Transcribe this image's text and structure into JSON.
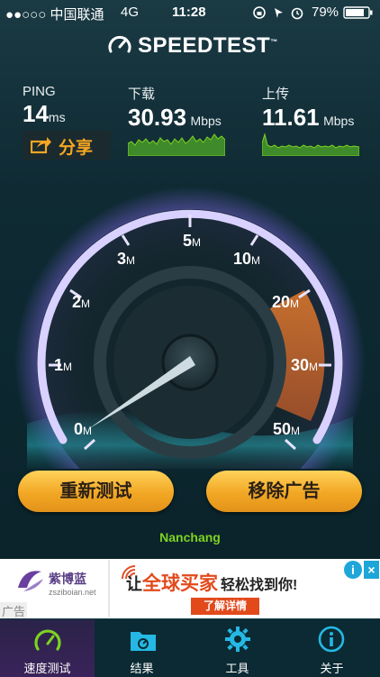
{
  "status": {
    "carrier": "●●○○○ 中国联通",
    "network": "4G",
    "time": "11:28",
    "battery_pct": "79%"
  },
  "header": {
    "brand": "SPEEDTEST",
    "trademark": "™"
  },
  "results": {
    "ping": {
      "label": "PING",
      "value": "14",
      "unit": "ms"
    },
    "download": {
      "label": "下载",
      "value": "30.93",
      "unit": "Mbps"
    },
    "upload": {
      "label": "上传",
      "value": "11.61",
      "unit": "Mbps"
    }
  },
  "share_label": "分享",
  "gauge": {
    "ticks": [
      {
        "num": "0",
        "unit": "M"
      },
      {
        "num": "1",
        "unit": "M"
      },
      {
        "num": "2",
        "unit": "M"
      },
      {
        "num": "3",
        "unit": "M"
      },
      {
        "num": "5",
        "unit": "M"
      },
      {
        "num": "10",
        "unit": "M"
      },
      {
        "num": "20",
        "unit": "M"
      },
      {
        "num": "30",
        "unit": "M"
      },
      {
        "num": "50",
        "unit": "M"
      }
    ]
  },
  "buttons": {
    "retest": "重新测试",
    "remove_ads": "移除广告"
  },
  "server": "Nanchang",
  "ad": {
    "advertiser_cn": "紫博蓝",
    "advertiser_url": "zsziboian.net",
    "headline_prefix": "让",
    "headline_main": "全球买家",
    "headline_suffix": "轻松找到你!",
    "cta": "了解详情",
    "tag": "广告"
  },
  "tabs": [
    {
      "label": "速度测试",
      "icon": "speedometer-icon"
    },
    {
      "label": "结果",
      "icon": "folder-icon"
    },
    {
      "label": "工具",
      "icon": "gear-icon"
    },
    {
      "label": "关于",
      "icon": "info-icon"
    }
  ],
  "colors": {
    "accent_orange": "#f5a623",
    "server_green": "#7ed321",
    "gauge_purple": "#c7b6ff"
  }
}
